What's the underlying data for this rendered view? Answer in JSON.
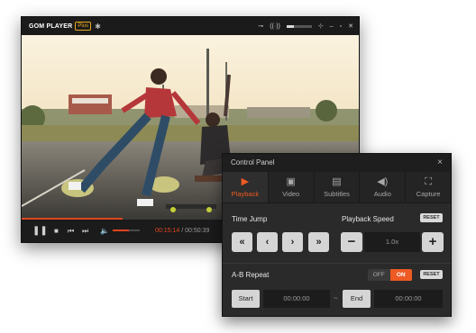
{
  "player": {
    "brand": "GOM PLAYER",
    "plus_badge": "Plus",
    "titlebar_icons": [
      "gear-icon",
      "key-icon",
      "surround-icon",
      "pin-icon",
      "minimize-icon",
      "restore-icon",
      "close-icon"
    ],
    "title_volume": 0.3,
    "progress": 0.3,
    "volume": 0.6,
    "time_current": "00:15:14",
    "time_separator": " / ",
    "time_total": "00:50:39",
    "accent": "#e0451e"
  },
  "panel": {
    "title": "Control Panel",
    "close": "×",
    "tabs": [
      {
        "label": "Playback",
        "icon": "play-icon",
        "active": true
      },
      {
        "label": "Video",
        "icon": "image-icon",
        "active": false
      },
      {
        "label": "Subtitles",
        "icon": "subtitles-icon",
        "active": false
      },
      {
        "label": "Audio",
        "icon": "speaker-icon",
        "active": false
      },
      {
        "label": "Capture",
        "icon": "capture-icon",
        "active": false
      }
    ],
    "time_jump_label": "Time Jump",
    "playback_speed_label": "Playback Speed",
    "reset_label": "RESET",
    "speed_value": "1.0x",
    "ab_repeat_label": "A-B Repeat",
    "toggle_off": "OFF",
    "toggle_on": "ON",
    "start_label": "Start",
    "start_time": "00:00:00",
    "range_separator": "~",
    "end_label": "End",
    "end_time": "00:00:00",
    "accent": "#ee5a24"
  }
}
